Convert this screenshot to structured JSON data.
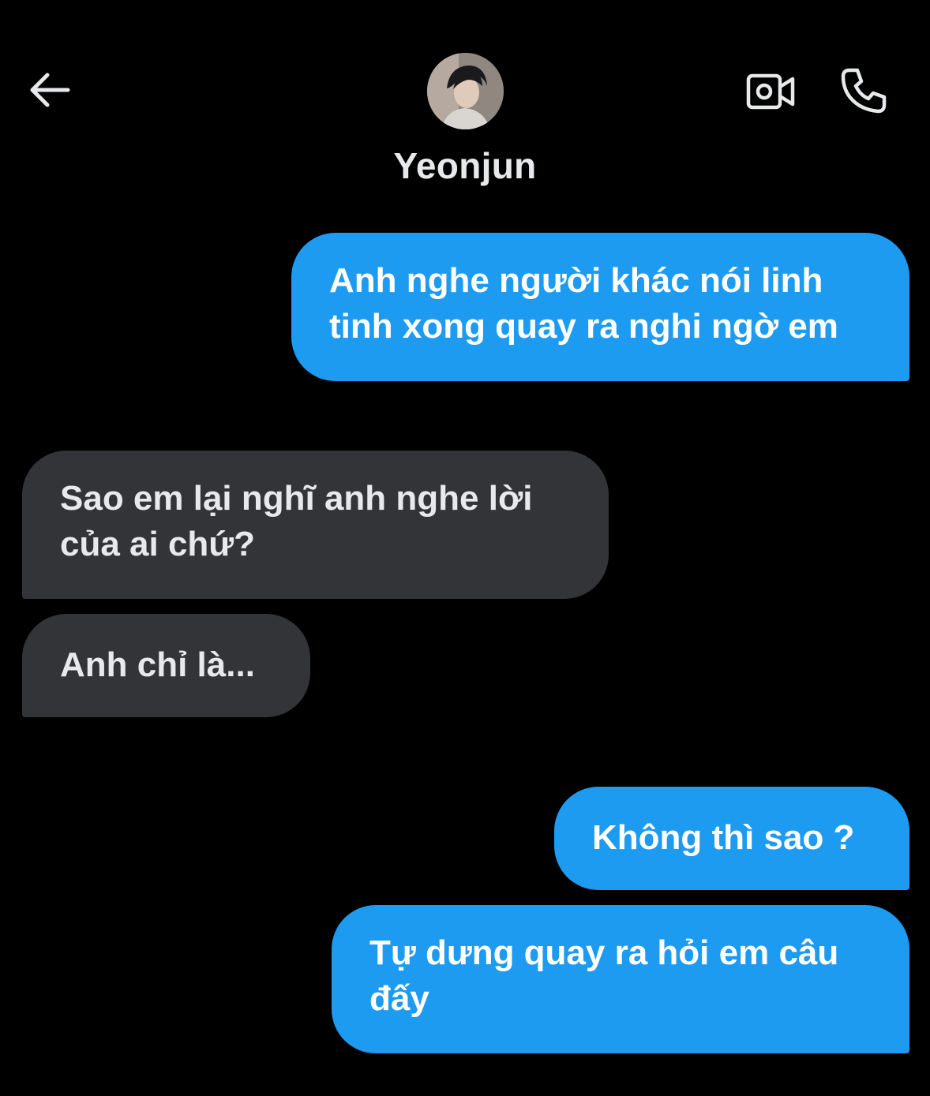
{
  "header": {
    "back_icon": "arrow-left-icon",
    "contact_name": "Yeonjun",
    "avatar_icon": "profile-photo",
    "video_icon": "video-camera-icon",
    "call_icon": "phone-icon",
    "icon_color": "#e7e9ea"
  },
  "messages": [
    {
      "side": "sent",
      "text": "Anh nghe người khác nói linh tinh xong quay ra nghi ngờ em"
    },
    {
      "side": "received",
      "text": "Sao em lại nghĩ anh nghe lời của ai chứ?"
    },
    {
      "side": "received",
      "text": "Anh chỉ là..."
    },
    {
      "side": "sent",
      "text": "Không thì sao ?"
    },
    {
      "side": "sent",
      "text": "Tự dưng quay ra hỏi em câu đấy"
    }
  ],
  "colors": {
    "background": "#000000",
    "sent_bubble": "#1d9bf0",
    "received_bubble": "#333438",
    "text": "#e7e9ea"
  }
}
